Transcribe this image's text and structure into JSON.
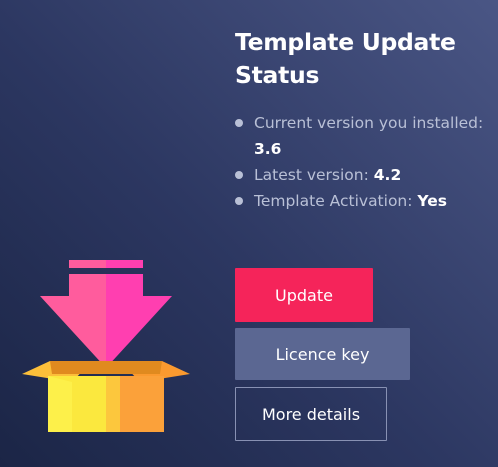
{
  "title": "Template Update Status",
  "status": {
    "current_label": "Current version you installed:",
    "current_value": "3.6",
    "latest_label": "Latest version:",
    "latest_value": "4.2",
    "activation_label": "Template Activation:",
    "activation_value": "Yes"
  },
  "buttons": {
    "update": "Update",
    "licence": "Licence key",
    "details": "More details"
  },
  "colors": {
    "background_dark": "#1b2546",
    "background_light": "#4a5685",
    "update_button": "#f5245a",
    "licence_button": "#5b6792",
    "details_border": "#8891b3",
    "bullet_text": "#b9c0d6",
    "arrow_pink": "#ff4fa8",
    "box_yellow": "#fcd83c",
    "box_orange": "#fba138"
  },
  "icons": {
    "illustration": "download-box-icon"
  }
}
